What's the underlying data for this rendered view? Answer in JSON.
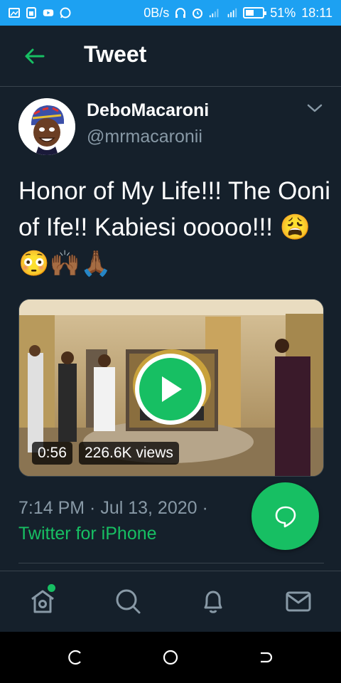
{
  "status_bar": {
    "network_speed": "0B/s",
    "battery_percent": "51%",
    "battery_level": 0.51,
    "time": "18:11",
    "color": "#1da1f2"
  },
  "header": {
    "back_icon": "arrow-left-icon",
    "title": "Tweet"
  },
  "tweet": {
    "author_name": "DeboMacaroni",
    "author_handle": "@mrmacaronii",
    "text": "Honor of My Life!!! The Ooni of Ife!! Kabiesi ooooo!!! 😩😳🙌🏾🙏🏾",
    "video": {
      "duration": "0:56",
      "views": "226.6K views"
    },
    "timestamp": "7:14 PM · Jul 13, 2020 · ",
    "source": "Twitter for iPhone"
  },
  "bottom_nav": {
    "items": [
      {
        "icon": "home-icon"
      },
      {
        "icon": "search-icon"
      },
      {
        "icon": "bell-icon"
      },
      {
        "icon": "mail-icon"
      }
    ]
  },
  "colors": {
    "background": "#15202b",
    "accent": "#17bf63",
    "secondary_text": "#8899a6"
  }
}
